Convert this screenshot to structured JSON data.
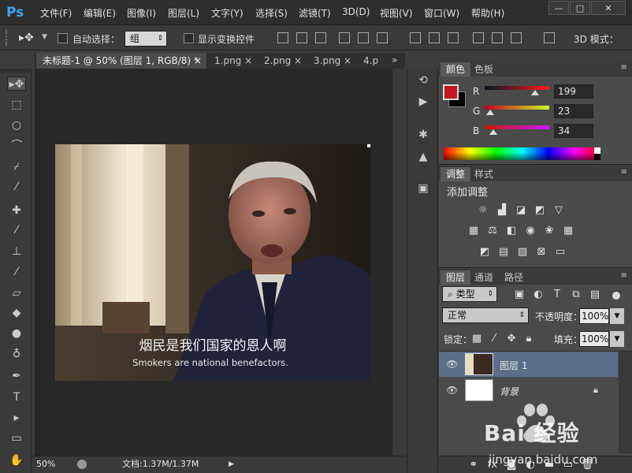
{
  "app": {
    "logo": "Ps"
  },
  "menu": [
    "文件(F)",
    "编辑(E)",
    "图像(I)",
    "图层(L)",
    "文字(Y)",
    "选择(S)",
    "滤镜(T)",
    "3D(D)",
    "视图(V)",
    "窗口(W)",
    "帮助(H)"
  ],
  "options": {
    "auto_select_label": "自动选择：",
    "auto_select_value": "组",
    "transform_label": "显示变换控件",
    "mode_3d_label": "3D 模式："
  },
  "tabs": [
    {
      "label": "未标题-1 @ 50% (图层 1, RGB/8) *"
    },
    {
      "label": "1.png"
    },
    {
      "label": "2.png"
    },
    {
      "label": "3.png"
    },
    {
      "label": "4.p"
    }
  ],
  "document": {
    "subtitle_cn": "烟民是我们国家的恩人啊",
    "subtitle_en": "Smokers are national benefactors."
  },
  "status": {
    "zoom": "50%",
    "doc_info": "文档:1.37M/1.37M"
  },
  "color_panel": {
    "tabs": [
      "颜色",
      "色板"
    ],
    "channels": [
      {
        "label": "R",
        "value": "199",
        "fraction": 0.78
      },
      {
        "label": "G",
        "value": "23",
        "fraction": 0.09
      },
      {
        "label": "B",
        "value": "34",
        "fraction": 0.13
      }
    ],
    "foreground": "#c71722",
    "background": "#000000"
  },
  "adjust_panel": {
    "tabs": [
      "调整",
      "样式"
    ],
    "title": "添加调整"
  },
  "layers_panel": {
    "tabs": [
      "图层",
      "通道",
      "路径"
    ],
    "filter_kind": "类型",
    "blend_mode": "正常",
    "opacity_label": "不透明度：",
    "opacity_value": "100%",
    "lock_label": "锁定：",
    "fill_label": "填充：",
    "fill_value": "100%",
    "layers": [
      {
        "name": "图层 1",
        "selected": true
      },
      {
        "name": "背景",
        "selected": false
      }
    ]
  },
  "watermark": {
    "brand": "Bai 经验",
    "url": "jingyan.baidu.com"
  }
}
